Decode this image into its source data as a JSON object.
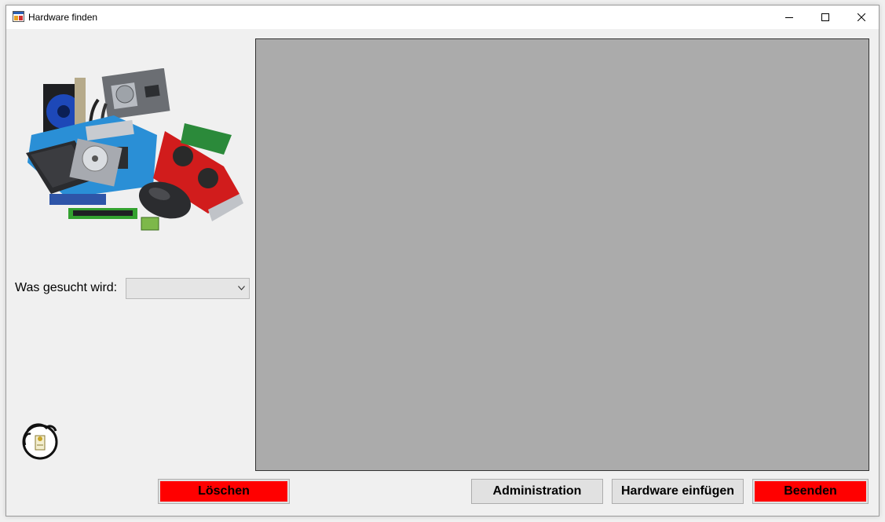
{
  "window": {
    "title": "Hardware finden",
    "icon": "app-window-icon",
    "controls": [
      "minimize-icon",
      "maximize-icon",
      "close-icon"
    ]
  },
  "images": {
    "hardware": "hardware-components-photo",
    "logo": "dragon-logo"
  },
  "search": {
    "label": "Was gesucht wird:",
    "selected_value": ""
  },
  "results": {
    "background": "#ababab"
  },
  "buttons": {
    "delete": "Löschen",
    "admin": "Administration",
    "insert": "Hardware einfügen",
    "exit": "Beenden"
  },
  "colors": {
    "danger": "#ff0000",
    "button": "#e1e1e1",
    "panel": "#ababab",
    "window": "#f0f0f0"
  }
}
